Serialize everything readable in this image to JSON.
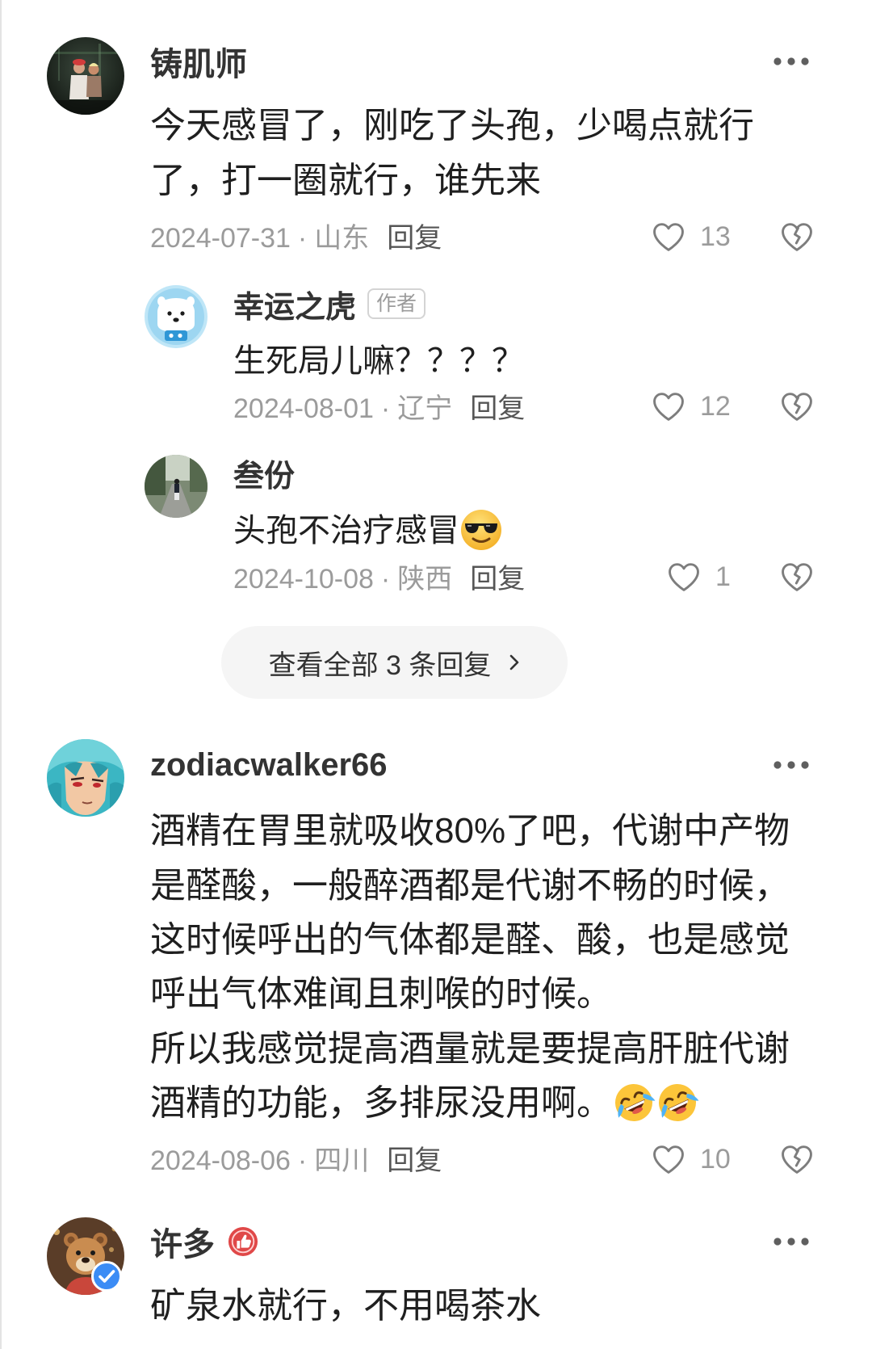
{
  "ui": {
    "meta_separator": "·",
    "icons": {
      "more": "more-horizontal-icon",
      "like": "heart-outline-icon",
      "dislike": "broken-heart-icon",
      "view_all": "chevron-right-icon"
    }
  },
  "colors": {
    "background": "#ffffff",
    "text": "#1f1f1f",
    "username": "#333333",
    "meta": "#9b9b9b",
    "reply_link": "#555555",
    "icon": "#7d7d7d",
    "pill_background": "#f5f5f5",
    "verified_badge": "#3b8cf5",
    "honor_badge": "#e04848"
  },
  "comments": [
    {
      "username": "铸肌师",
      "text_lines": [
        "今天感冒了，刚吃了头孢，少喝点就行",
        "了，打一圈就行，谁先来"
      ],
      "date": "2024-07-31",
      "location": "山东",
      "reply_label": "回复",
      "likes": "13",
      "replies": [
        {
          "username": "幸运之虎",
          "tag": "作者",
          "text": "生死局儿嘛？？？？",
          "date": "2024-08-01",
          "location": "辽宁",
          "reply_label": "回复",
          "likes": "12"
        },
        {
          "username": "叁份",
          "text": "头孢不治疗感冒",
          "emojis": [
            "smiling-face-with-sunglasses-emoji"
          ],
          "date": "2024-10-08",
          "location": "陕西",
          "reply_label": "回复",
          "likes": "1"
        }
      ],
      "view_all_label": "查看全部 3 条回复"
    },
    {
      "username": "zodiacwalker66",
      "text_lines": [
        "酒精在胃里就吸收80%了吧，代谢中产物",
        "是醛酸，一般醉酒都是代谢不畅的时候，",
        "这时候呼出的气体都是醛、酸，也是感觉",
        "呼出气体难闻且刺喉的时候。",
        "所以我感觉提高酒量就是要提高肝脏代谢",
        "酒精的功能，多排尿没用啊。"
      ],
      "emojis": [
        "rolling-on-the-floor-laughing-emoji",
        "rolling-on-the-floor-laughing-emoji"
      ],
      "date": "2024-08-06",
      "location": "四川",
      "reply_label": "回复",
      "likes": "10"
    },
    {
      "username": "许多",
      "badges": [
        "verified-badge-icon",
        "honor-medal-icon"
      ],
      "text_lines": [
        "矿泉水就行，不用喝茶水"
      ]
    }
  ]
}
